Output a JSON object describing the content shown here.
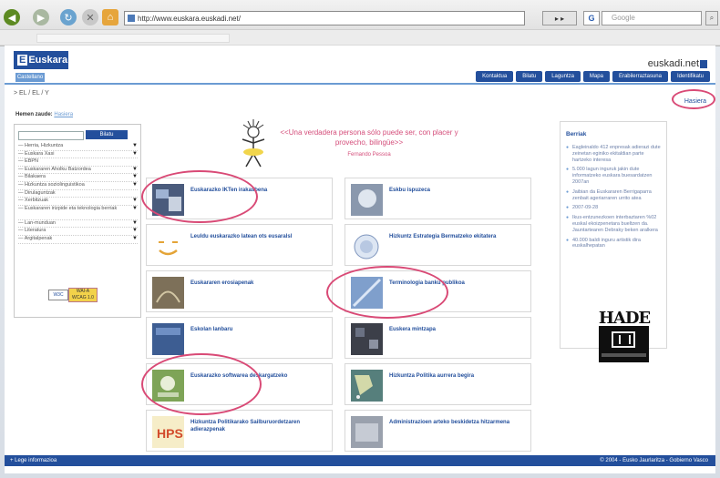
{
  "browser": {
    "url": "http://www.euskara.euskadi.net/",
    "go_label": "",
    "search_placeholder": "Google",
    "search_engine_label": "G"
  },
  "site": {
    "logo_text": "Euskara",
    "brand": "euskadi.net",
    "language_button": "Castellano",
    "menu": [
      "Kontaktua",
      "Bilatu",
      "Laguntza",
      "Mapa",
      "Erabilerraztasuna",
      "Identifikatu"
    ],
    "breadcrumb": "> EL / EL / Y",
    "hasiera": "Hasiera"
  },
  "sidebar": {
    "title": "Hemen zaude:",
    "title_link": "Hasiera",
    "search_button": "Bilatu",
    "items": [
      {
        "label": "— Herria, Hizkuntza",
        "arrow": true
      },
      {
        "label": "— Euskara Xasi",
        "arrow": true
      },
      {
        "label": "— EBPN",
        "arrow": false
      },
      {
        "label": "— Euskararen Aholku Batzordea",
        "arrow": true
      },
      {
        "label": "— Bilakaera",
        "arrow": true
      },
      {
        "label": "— Hizkuntza soziolinguistikoa",
        "arrow": true
      },
      {
        "label": "— Dirulaguntzak",
        "arrow": false
      },
      {
        "label": "— Xerbitzuak",
        "arrow": true
      },
      {
        "label": "— Euskararen irizpide eta teknologia berriak",
        "arrow": true
      },
      {
        "label": "— Lan-munduan",
        "arrow": true
      },
      {
        "label": "— Literatura",
        "arrow": true
      },
      {
        "label": "— Argitalpenak",
        "arrow": true
      }
    ],
    "wai_label": "W3C",
    "wai_level": "WAI-A\nWCAG 1.0"
  },
  "quote": {
    "text": "<<Una verdadera persona sólo puede ser, con placer y provecho, bilingüe>>",
    "signature": "Fernando Pessoa"
  },
  "tiles": [
    {
      "label": "Euskarazko IKTen irakasbena"
    },
    {
      "label": "Eskbu ispuzeca"
    },
    {
      "label": "Leuldu euskarazko latean ots eusaralsl"
    },
    {
      "label": "Hizkuntz Estrategia Bermatzeko ekitatera"
    },
    {
      "label": "Euskararen erosiapenak"
    },
    {
      "label": "Terminologia banku publikoa"
    },
    {
      "label": "Eskolan lanbaru"
    },
    {
      "label": "Euskera mintzapa"
    },
    {
      "label": "Euskarazko softwarea deskargatzeko"
    },
    {
      "label": "Hizkuntza Politika aurrera begira"
    },
    {
      "label": "Hizkuntza Politikarako Sailburuordetzaren adierazpenak"
    },
    {
      "label": "Administrazioen arteko beskidetza hitzarmena"
    }
  ],
  "news": {
    "title": "Berriak",
    "items": [
      "Eagleinaldo 412 enpresak adierazi dute zeinetan eginiko ekitaldian parte hartzeko interesa",
      "5.000 lagun inguruk jakin dute informatzeko euskara buesardatzen 2007an",
      "Jaibian da Euskararen Berrigaparra zenbait ageriarraren urrito atea",
      "2007-09-28",
      "Ikus-entzunezkoen interbaztaren %02 euskal ekoizpenetara bueltzen da. Jauntartearen Debraky beken aralkera",
      "40.000 baldi inguru artistik dira euskalhepatan"
    ]
  },
  "hade": {
    "title": "HADE"
  },
  "footer": {
    "left": "+ Lege informazioa",
    "right": "© 2004 - Eusko Jaurlaritza - Gobierno Vasco"
  },
  "colors": {
    "primary": "#234f9c",
    "accent_light": "#6b9bd3",
    "highlight_circle": "#d94a76",
    "quote": "#d44d7a"
  }
}
